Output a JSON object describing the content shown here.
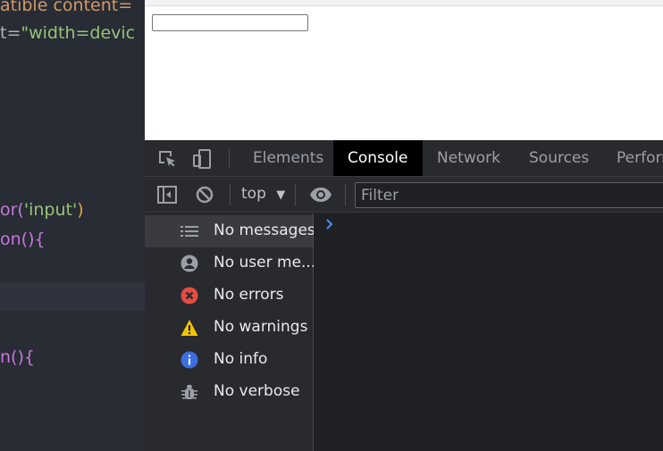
{
  "editor": {
    "lines": [
      {
        "parts": [
          {
            "t": "atible ",
            "c": "tok-attr"
          },
          {
            "t": " content=",
            "c": "tok-attr"
          }
        ]
      },
      {
        "parts": [
          {
            "t": "t=",
            "c": "tok-plain"
          },
          {
            "t": "\"width=devic",
            "c": "tok-str"
          }
        ]
      },
      {
        "parts": [
          {
            "t": "or(",
            "c": "tok-fn"
          },
          {
            "t": "'input'",
            "c": "tok-str"
          },
          {
            "t": ")",
            "c": "tok-paren"
          }
        ]
      },
      {
        "parts": [
          {
            "t": "on(){",
            "c": "tok-fn"
          }
        ]
      },
      {
        "parts": [
          {
            "t": "n(){",
            "c": "tok-fn"
          }
        ]
      }
    ]
  },
  "devtools": {
    "tabs": [
      "Elements",
      "Console",
      "Network",
      "Sources",
      "Perform"
    ],
    "active_tab": "Console",
    "toolbar": {
      "context": "top",
      "filter_placeholder": "Filter"
    },
    "sidebar": [
      {
        "label": "No messages",
        "icon": "list-icon",
        "selected": true
      },
      {
        "label": "No user me...",
        "icon": "user-icon"
      },
      {
        "label": "No errors",
        "icon": "error-icon"
      },
      {
        "label": "No warnings",
        "icon": "warning-icon"
      },
      {
        "label": "No info",
        "icon": "info-icon"
      },
      {
        "label": "No verbose",
        "icon": "bug-icon"
      }
    ]
  },
  "colors": {
    "error": "#e54d42",
    "warning": "#f2c500",
    "info": "#3b6ee0",
    "prompt": "#4d8ef8"
  }
}
